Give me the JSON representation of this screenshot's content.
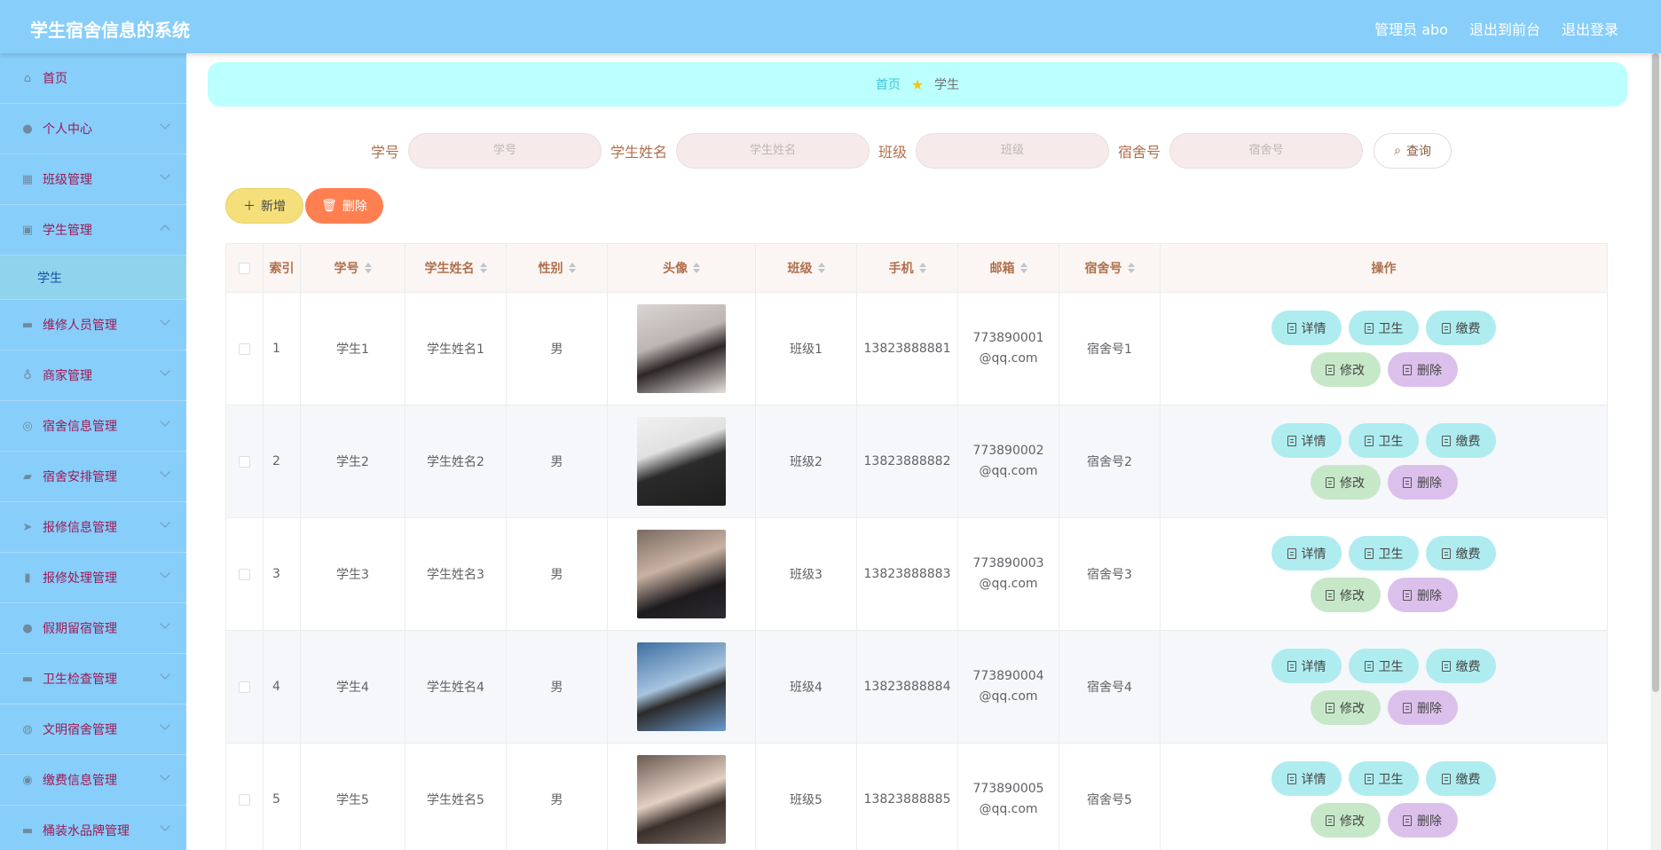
{
  "header": {
    "title": "学生宿舍信息的系统",
    "admin": "管理员 abo",
    "to_front": "退出到前台",
    "logout": "退出登录"
  },
  "sidebar": {
    "items": [
      {
        "label": "首页",
        "icon": "home-icon",
        "glyph": "⌂"
      },
      {
        "label": "个人中心",
        "icon": "user-icon",
        "glyph": "●"
      },
      {
        "label": "班级管理",
        "icon": "grid-icon",
        "glyph": "▦"
      },
      {
        "label": "学生管理",
        "icon": "clipboard-icon",
        "glyph": "▣"
      },
      {
        "label": "维修人员管理",
        "icon": "briefcase-icon",
        "glyph": "▬"
      },
      {
        "label": "商家管理",
        "icon": "microphone-icon",
        "glyph": "♁"
      },
      {
        "label": "宿舍信息管理",
        "icon": "compass-icon",
        "glyph": "◎"
      },
      {
        "label": "宿舍安排管理",
        "icon": "chat-icon",
        "glyph": "▰"
      },
      {
        "label": "报修信息管理",
        "icon": "send-icon",
        "glyph": "➤"
      },
      {
        "label": "报修处理管理",
        "icon": "bar-chart-icon",
        "glyph": "▮"
      },
      {
        "label": "假期留宿管理",
        "icon": "location-icon",
        "glyph": "●"
      },
      {
        "label": "卫生检查管理",
        "icon": "ticket-icon",
        "glyph": "▬"
      },
      {
        "label": "文明宿舍管理",
        "icon": "basketball-icon",
        "glyph": "◍"
      },
      {
        "label": "缴费信息管理",
        "icon": "target-icon",
        "glyph": "◉"
      },
      {
        "label": "桶装水品牌管理",
        "icon": "suitcase-icon",
        "glyph": "▬"
      }
    ],
    "submenu": {
      "label": "学生"
    }
  },
  "breadcrumb": {
    "home": "首页",
    "current": "学生"
  },
  "search": {
    "fields": [
      {
        "label": "学号",
        "placeholder": "学号"
      },
      {
        "label": "学生姓名",
        "placeholder": "学生姓名"
      },
      {
        "label": "班级",
        "placeholder": "班级"
      },
      {
        "label": "宿舍号",
        "placeholder": "宿舍号"
      }
    ],
    "query_label": "查询"
  },
  "actions": {
    "add_label": "新增",
    "delete_label": "删除"
  },
  "table": {
    "headers": [
      "索引",
      "学号",
      "学生姓名",
      "性别",
      "头像",
      "班级",
      "手机",
      "邮箱",
      "宿舍号",
      "操作"
    ],
    "rows": [
      {
        "idx": "1",
        "xuehao": "学生1",
        "name": "学生姓名1",
        "gender": "男",
        "banji": "班级1",
        "phone": "13823888881",
        "email": "773890001@qq.com",
        "sushe": "宿舍号1"
      },
      {
        "idx": "2",
        "xuehao": "学生2",
        "name": "学生姓名2",
        "gender": "男",
        "banji": "班级2",
        "phone": "13823888882",
        "email": "773890002@qq.com",
        "sushe": "宿舍号2"
      },
      {
        "idx": "3",
        "xuehao": "学生3",
        "name": "学生姓名3",
        "gender": "男",
        "banji": "班级3",
        "phone": "13823888883",
        "email": "773890003@qq.com",
        "sushe": "宿舍号3"
      },
      {
        "idx": "4",
        "xuehao": "学生4",
        "name": "学生姓名4",
        "gender": "男",
        "banji": "班级4",
        "phone": "13823888884",
        "email": "773890004@qq.com",
        "sushe": "宿舍号4"
      },
      {
        "idx": "5",
        "xuehao": "学生5",
        "name": "学生姓名5",
        "gender": "男",
        "banji": "班级5",
        "phone": "13823888885",
        "email": "773890005@qq.com",
        "sushe": "宿舍号5"
      }
    ],
    "row_buttons": {
      "detail": "详情",
      "hygiene": "卫生",
      "pay": "缴费",
      "edit": "修改",
      "delete": "删除"
    }
  },
  "colors": {
    "header": "#87cefa",
    "sidebar": "#87cefa",
    "breadcrumb": "#bbfffe",
    "add": "#f5df7a",
    "delete": "#ff7f50"
  }
}
